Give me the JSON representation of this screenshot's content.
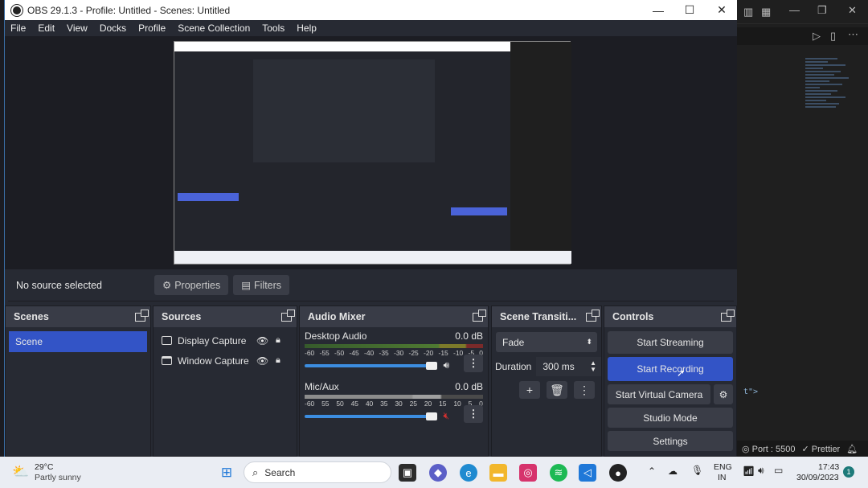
{
  "window": {
    "title": "OBS 29.1.3 - Profile: Untitled - Scenes: Untitled",
    "minimize": "—",
    "maximize": "☐",
    "close": "✕"
  },
  "menu": [
    "File",
    "Edit",
    "View",
    "Docks",
    "Profile",
    "Scene Collection",
    "Tools",
    "Help"
  ],
  "context": {
    "no_source": "No source selected",
    "properties": "Properties",
    "filters": "Filters"
  },
  "scenes": {
    "title": "Scenes",
    "items": [
      "Scene"
    ]
  },
  "sources": {
    "title": "Sources",
    "items": [
      "Display Capture",
      "Window Capture"
    ]
  },
  "mixer": {
    "title": "Audio Mixer",
    "channels": [
      {
        "name": "Desktop Audio",
        "db": "0.0 dB",
        "muted": false
      },
      {
        "name": "Mic/Aux",
        "db": "0.0 dB",
        "muted": true
      }
    ],
    "scale": [
      "-60",
      "-55",
      "-50",
      "-45",
      "-40",
      "-35",
      "-30",
      "-25",
      "-20",
      "-15",
      "-10",
      "-5",
      "0"
    ],
    "scale_b": [
      "-60",
      "55",
      "50",
      "45",
      "40",
      "35",
      "30",
      "25",
      "20",
      "15",
      "10",
      "5",
      "0"
    ]
  },
  "transitions": {
    "title": "Scene Transiti...",
    "selected": "Fade",
    "duration_label": "Duration",
    "duration": "300 ms"
  },
  "controls": {
    "title": "Controls",
    "start_streaming": "Start Streaming",
    "start_recording": "Start Recording",
    "start_virtual_camera": "Start Virtual Camera",
    "studio_mode": "Studio Mode",
    "settings": "Settings"
  },
  "vscode": {
    "port": "Port : 5500",
    "prettier": "Prettier",
    "snippet": "t\">"
  },
  "taskbar": {
    "temp": "29°C",
    "weather": "Partly sunny",
    "search": "Search",
    "lang1": "ENG",
    "lang2": "IN",
    "time": "17:43",
    "date": "30/09/2023",
    "badge": "1"
  },
  "colors": {
    "accent": "#3354c6",
    "panel": "#272a33",
    "header": "#393c47"
  }
}
